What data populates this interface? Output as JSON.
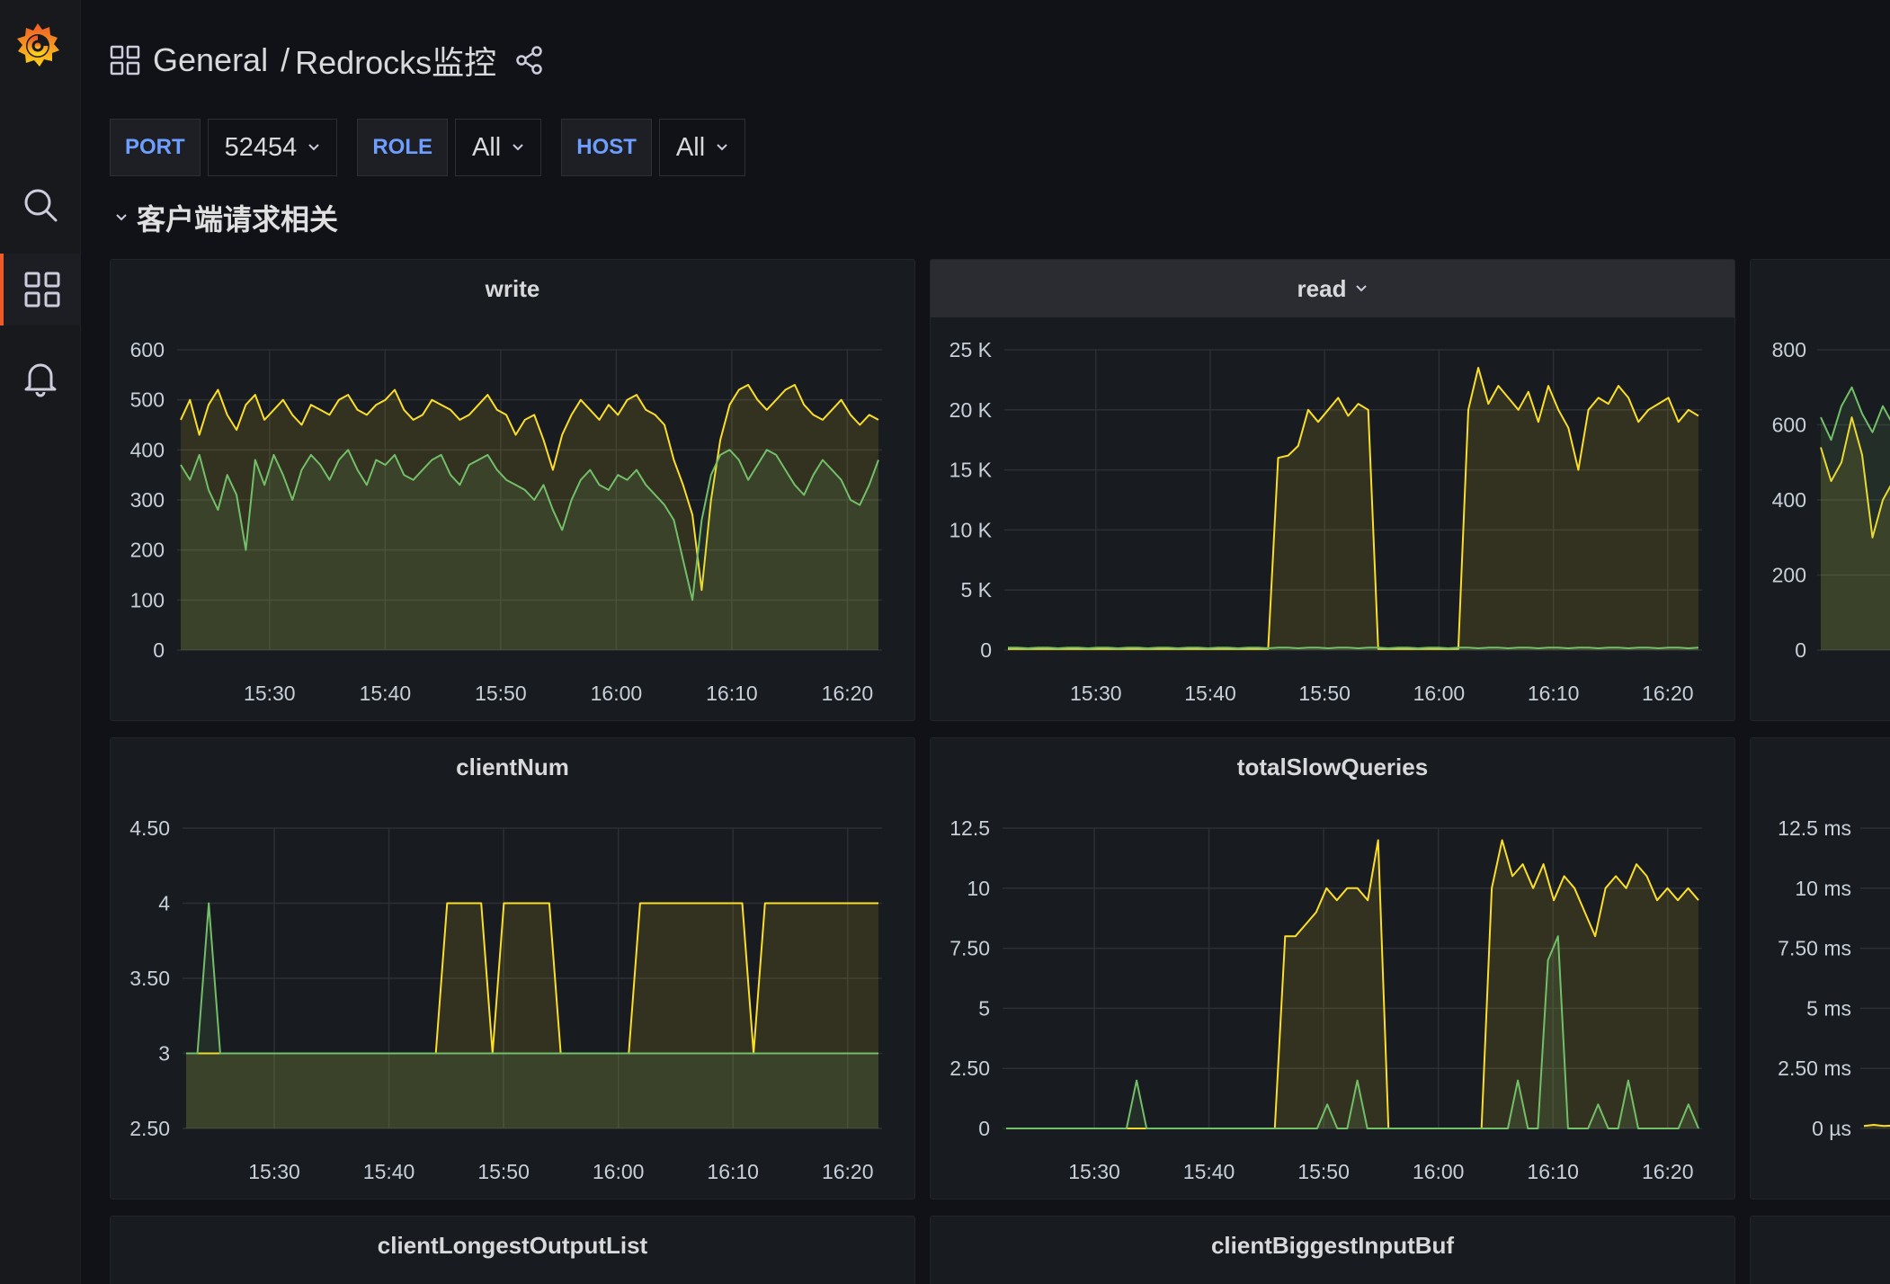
{
  "header": {
    "folder": "General",
    "separator": "/",
    "dashboard": "Redrocks监控"
  },
  "variables": [
    {
      "label": "PORT",
      "value": "52454"
    },
    {
      "label": "ROLE",
      "value": "All"
    },
    {
      "label": "HOST",
      "value": "All"
    }
  ],
  "row": {
    "title": "客户端请求相关"
  },
  "sidebar": {
    "icons": [
      "grafana-logo-icon",
      "search-icon",
      "dashboards-icon",
      "alerting-bell-icon"
    ],
    "active": "dashboards-icon",
    "accent": "#f05a28"
  },
  "colors": {
    "series_yellow": "#fade2a",
    "series_green": "#73bf69",
    "var_label": "#6e9fff",
    "background": "#111217",
    "panel": "#181b1f"
  },
  "panels": {
    "write": {
      "title": "write"
    },
    "read": {
      "title": "read"
    },
    "clientNum": {
      "title": "clientNum"
    },
    "totalSlowQueries": {
      "title": "totalSlowQueries"
    },
    "right_top": {
      "title": ""
    },
    "right_mid": {
      "title": ""
    },
    "clientLongestOutputList": {
      "title": "clientLongestOutputList"
    },
    "clientBiggestInputBuf": {
      "title": "clientBiggestInputBuf"
    }
  },
  "chart_data": [
    {
      "id": "write",
      "type": "area",
      "title": "write",
      "x_ticks": [
        "15:30",
        "15:40",
        "15:50",
        "16:00",
        "16:10",
        "16:20"
      ],
      "y_ticks": [
        "600",
        "500",
        "400",
        "300",
        "200",
        "100",
        "0"
      ],
      "ylim": [
        0,
        600
      ],
      "xlim_minutes": [
        22,
        83
      ],
      "grid": true,
      "series": [
        {
          "color": "#fade2a",
          "values": [
            460,
            500,
            430,
            490,
            520,
            470,
            440,
            490,
            510,
            460,
            480,
            500,
            470,
            450,
            490,
            480,
            470,
            500,
            510,
            480,
            470,
            490,
            500,
            520,
            480,
            460,
            470,
            500,
            490,
            480,
            460,
            470,
            490,
            510,
            480,
            470,
            430,
            460,
            470,
            420,
            360,
            430,
            470,
            500,
            480,
            460,
            490,
            470,
            500,
            510,
            480,
            470,
            450,
            380,
            330,
            270,
            120,
            300,
            420,
            490,
            520,
            530,
            500,
            480,
            500,
            520,
            530,
            490,
            470,
            460,
            480,
            500,
            470,
            450,
            470,
            460
          ]
        },
        {
          "color": "#73bf69",
          "values": [
            370,
            340,
            390,
            320,
            280,
            350,
            310,
            200,
            380,
            330,
            390,
            350,
            300,
            360,
            390,
            370,
            340,
            380,
            400,
            360,
            330,
            380,
            370,
            390,
            350,
            340,
            360,
            380,
            390,
            350,
            330,
            370,
            380,
            390,
            360,
            340,
            330,
            320,
            300,
            330,
            280,
            240,
            300,
            340,
            360,
            330,
            320,
            350,
            340,
            360,
            330,
            310,
            290,
            260,
            180,
            100,
            260,
            350,
            390,
            400,
            380,
            340,
            370,
            400,
            390,
            360,
            330,
            310,
            350,
            380,
            360,
            340,
            300,
            290,
            330,
            380
          ]
        }
      ]
    },
    {
      "id": "read",
      "type": "area",
      "title": "read",
      "x_ticks": [
        "15:30",
        "15:40",
        "15:50",
        "16:00",
        "16:10",
        "16:20"
      ],
      "y_ticks": [
        "25 K",
        "20 K",
        "15 K",
        "10 K",
        "5 K",
        "0"
      ],
      "ylim": [
        0,
        25000
      ],
      "xlim_minutes": [
        22,
        83
      ],
      "grid": true,
      "series": [
        {
          "color": "#fade2a",
          "values": [
            100,
            100,
            100,
            100,
            100,
            100,
            100,
            100,
            100,
            100,
            100,
            100,
            100,
            100,
            100,
            100,
            100,
            100,
            100,
            100,
            100,
            100,
            100,
            100,
            100,
            100,
            100,
            16000,
            16200,
            17000,
            20000,
            19000,
            20000,
            21000,
            19500,
            20500,
            20000,
            100,
            100,
            100,
            100,
            100,
            100,
            100,
            100,
            100,
            20000,
            23500,
            20500,
            22000,
            21000,
            20000,
            21500,
            19000,
            22000,
            20000,
            18500,
            15000,
            20000,
            21000,
            20500,
            22000,
            21000,
            19000,
            20000,
            20500,
            21000,
            19000,
            20000,
            19500
          ]
        },
        {
          "color": "#73bf69",
          "values": [
            200,
            200,
            150,
            200,
            200,
            150,
            200,
            200,
            150,
            200,
            200,
            150,
            200,
            200,
            150,
            200,
            200,
            150,
            200,
            200,
            150,
            200,
            200,
            150,
            200,
            200,
            150,
            200,
            200,
            150,
            200,
            200,
            150,
            200,
            200,
            150,
            200,
            200,
            150,
            200,
            200,
            150,
            200,
            200,
            150,
            200,
            200,
            150,
            200,
            200,
            150,
            200,
            200,
            150,
            200,
            200,
            150,
            200,
            200,
            150,
            200,
            200,
            150,
            200,
            200,
            150,
            200,
            200,
            150,
            200
          ]
        }
      ]
    },
    {
      "id": "clientNum",
      "type": "area",
      "title": "clientNum",
      "x_ticks": [
        "15:30",
        "15:40",
        "15:50",
        "16:00",
        "16:10",
        "16:20"
      ],
      "y_ticks": [
        "4.50",
        "4",
        "3.50",
        "3",
        "2.50"
      ],
      "ylim": [
        2.5,
        4.5
      ],
      "xlim_minutes": [
        22,
        83
      ],
      "grid": true,
      "series": [
        {
          "color": "#fade2a",
          "values": [
            3,
            3,
            3,
            3,
            3,
            3,
            3,
            3,
            3,
            3,
            3,
            3,
            3,
            3,
            3,
            3,
            3,
            3,
            3,
            3,
            3,
            3,
            3,
            4,
            4,
            4,
            4,
            3,
            4,
            4,
            4,
            4,
            4,
            3,
            3,
            3,
            3,
            3,
            3,
            3,
            4,
            4,
            4,
            4,
            4,
            4,
            4,
            4,
            4,
            4,
            3,
            4,
            4,
            4,
            4,
            4,
            4,
            4,
            4,
            4,
            4,
            4
          ]
        },
        {
          "color": "#73bf69",
          "values": [
            3,
            3,
            4,
            3,
            3,
            3,
            3,
            3,
            3,
            3,
            3,
            3,
            3,
            3,
            3,
            3,
            3,
            3,
            3,
            3,
            3,
            3,
            3,
            3,
            3,
            3,
            3,
            3,
            3,
            3,
            3,
            3,
            3,
            3,
            3,
            3,
            3,
            3,
            3,
            3,
            3,
            3,
            3,
            3,
            3,
            3,
            3,
            3,
            3,
            3,
            3,
            3,
            3,
            3,
            3,
            3,
            3,
            3,
            3,
            3,
            3,
            3
          ]
        }
      ]
    },
    {
      "id": "totalSlowQueries",
      "type": "area",
      "title": "totalSlowQueries",
      "x_ticks": [
        "15:30",
        "15:40",
        "15:50",
        "16:00",
        "16:10",
        "16:20"
      ],
      "y_ticks": [
        "12.5",
        "10",
        "7.50",
        "5",
        "2.50",
        "0"
      ],
      "ylim": [
        0,
        12.5
      ],
      "xlim_minutes": [
        22,
        83
      ],
      "grid": true,
      "series": [
        {
          "color": "#fade2a",
          "values": [
            0,
            0,
            0,
            0,
            0,
            0,
            0,
            0,
            0,
            0,
            0,
            0,
            0,
            0,
            0,
            0,
            0,
            0,
            0,
            0,
            0,
            0,
            0,
            0,
            0,
            0,
            0,
            8,
            8,
            8.5,
            9,
            10,
            9.5,
            10,
            10,
            9.5,
            12,
            0,
            0,
            0,
            0,
            0,
            0,
            0,
            0,
            0,
            0,
            10,
            12,
            10.5,
            11,
            10,
            11,
            9.5,
            10.5,
            10,
            9,
            8,
            10,
            10.5,
            10,
            11,
            10.5,
            9.5,
            10,
            9.5,
            10,
            9.5
          ]
        },
        {
          "color": "#73bf69",
          "values": [
            0,
            0,
            0,
            0,
            0,
            0,
            0,
            0,
            0,
            0,
            0,
            0,
            0,
            2,
            0,
            0,
            0,
            0,
            0,
            0,
            0,
            0,
            0,
            0,
            0,
            0,
            0,
            0,
            0,
            0,
            0,
            0,
            1,
            0,
            0,
            2,
            0,
            0,
            0,
            0,
            0,
            0,
            0,
            0,
            0,
            0,
            0,
            0,
            0,
            0,
            0,
            2,
            0,
            0,
            7,
            8,
            0,
            0,
            0,
            1,
            0,
            0,
            2,
            0,
            0,
            0,
            0,
            0,
            1,
            0
          ]
        }
      ]
    },
    {
      "id": "right_top",
      "type": "area",
      "title": "",
      "y_ticks": [
        "800",
        "600",
        "400",
        "200",
        "0"
      ],
      "ylim": [
        0,
        800
      ],
      "grid": true,
      "series": [
        {
          "color": "#fade2a",
          "values": [
            540,
            450,
            500,
            620,
            520,
            300,
            400,
            450,
            380
          ]
        },
        {
          "color": "#73bf69",
          "values": [
            620,
            560,
            650,
            700,
            630,
            580,
            650,
            600,
            550
          ]
        }
      ]
    },
    {
      "id": "right_mid",
      "type": "area",
      "title": "",
      "y_ticks": [
        "12.5 ms",
        "10 ms",
        "7.50 ms",
        "5 ms",
        "2.50 ms",
        "0 µs"
      ],
      "ylim": [
        0,
        12.5
      ],
      "grid": true,
      "series": [
        {
          "color": "#fade2a",
          "values": [
            0.1,
            0.15,
            0.1,
            0.12,
            0.1
          ]
        }
      ]
    }
  ]
}
